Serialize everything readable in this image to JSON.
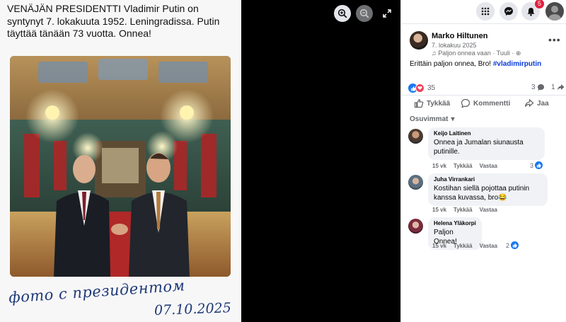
{
  "post_image": {
    "caption": "VENÄJÄN PRESIDENTTI Vladimir Putin on syntynyt 7. lokakuuta 1952. Leningradissa. Putin täyttää tänään 73 vuotta. Onnea!",
    "handwritten_line1": "фото с президентом",
    "handwritten_line2": "07.10.2025"
  },
  "viewer": {
    "icons": [
      "zoom-in-icon",
      "zoom-out-icon",
      "fullscreen-icon"
    ]
  },
  "top_actions": {
    "notification_count": "5",
    "icons": [
      "menu-grid-icon",
      "messenger-icon",
      "bell-icon"
    ]
  },
  "post": {
    "author": "Marko Hiltunen",
    "date": "7. lokakuu 2025",
    "meta_song": "Paljon onnea vaan · Tuuli ·",
    "text": "Erittäin paljon onnea, Bro! ",
    "hashtag": "#vladimirputin",
    "reaction_count": "35",
    "comment_count": "3",
    "share_count": "1",
    "actions": {
      "like": "Tykkää",
      "comment": "Kommentti",
      "share": "Jaa"
    },
    "sort_label": "Osuvimmat"
  },
  "comments": [
    {
      "name": "Keijo Laitinen",
      "text_line1": "Onnea ja Jumalan siunausta",
      "text_line2": "putinille.",
      "time": "15 vk",
      "like": "Tykkää",
      "reply": "Vastaa",
      "reactions": "3"
    },
    {
      "name": "Juha Virrankari",
      "text_line1": "Kostihan siellä pojottaa putinin",
      "text_line2": "kanssa kuvassa, bro😂",
      "time": "15 vk",
      "like": "Tykkää",
      "reply": "Vastaa",
      "reactions": ""
    },
    {
      "name": "Helena Yläkorpi",
      "text_line1": "Paljon Onnea!",
      "text_line2": "",
      "time": "15 vk",
      "like": "Tykkää",
      "reply": "Vastaa",
      "reactions": "2"
    }
  ],
  "colors": {
    "accent": "#1877f2",
    "hashtag": "#0a3bdc",
    "badge": "#e41e3f",
    "heart": "#f33e58",
    "handwriting": "#1f3a78"
  }
}
